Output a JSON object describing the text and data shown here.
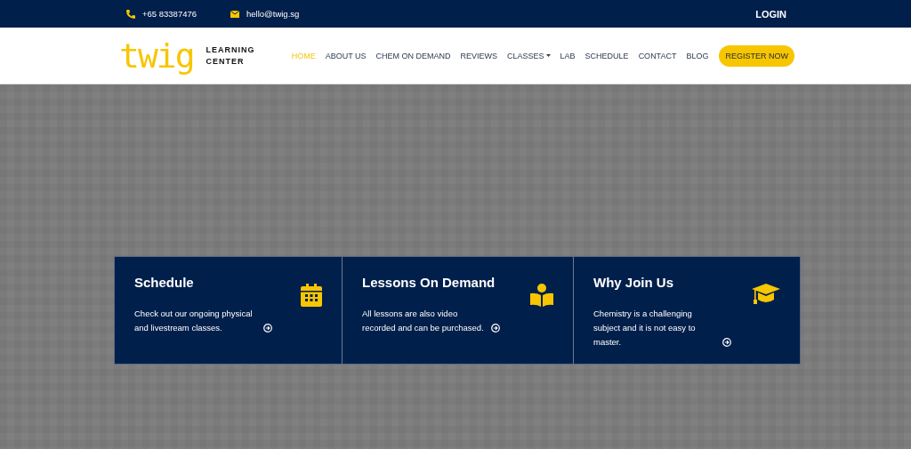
{
  "top_bar": {
    "phone": "+65 83387476",
    "email": "hello@twig.sg",
    "login": "LOGIN"
  },
  "header": {
    "logo": {
      "wordmark": "twig",
      "line_1": "LEARNING",
      "line_2": "CENTER"
    },
    "nav": [
      {
        "label": "HOME",
        "selected": true,
        "dropdown": false
      },
      {
        "label": "ABOUT US",
        "selected": false,
        "dropdown": false
      },
      {
        "label": "CHEM ON DEMAND",
        "selected": false,
        "dropdown": false
      },
      {
        "label": "REVIEWS",
        "selected": false,
        "dropdown": false
      },
      {
        "label": "CLASSES",
        "selected": false,
        "dropdown": true
      },
      {
        "label": "LAB",
        "selected": false,
        "dropdown": false
      },
      {
        "label": "SCHEDULE",
        "selected": false,
        "dropdown": false
      },
      {
        "label": "CONTACT",
        "selected": false,
        "dropdown": false
      },
      {
        "label": "BLOG",
        "selected": false,
        "dropdown": false
      }
    ],
    "cta": "REGISTER NOW"
  },
  "cards": [
    {
      "title": "Schedule",
      "text": "Check out our ongoing physical and livestream classes.",
      "kind": "calendar"
    },
    {
      "title": "Lessons On Demand",
      "text": "All lessons are also video recorded and can be purchased.",
      "kind": "reader"
    },
    {
      "title": "Why Join Us",
      "text": "Chemistry is a challenging subject and it is not easy to master.",
      "kind": "cap"
    }
  ]
}
